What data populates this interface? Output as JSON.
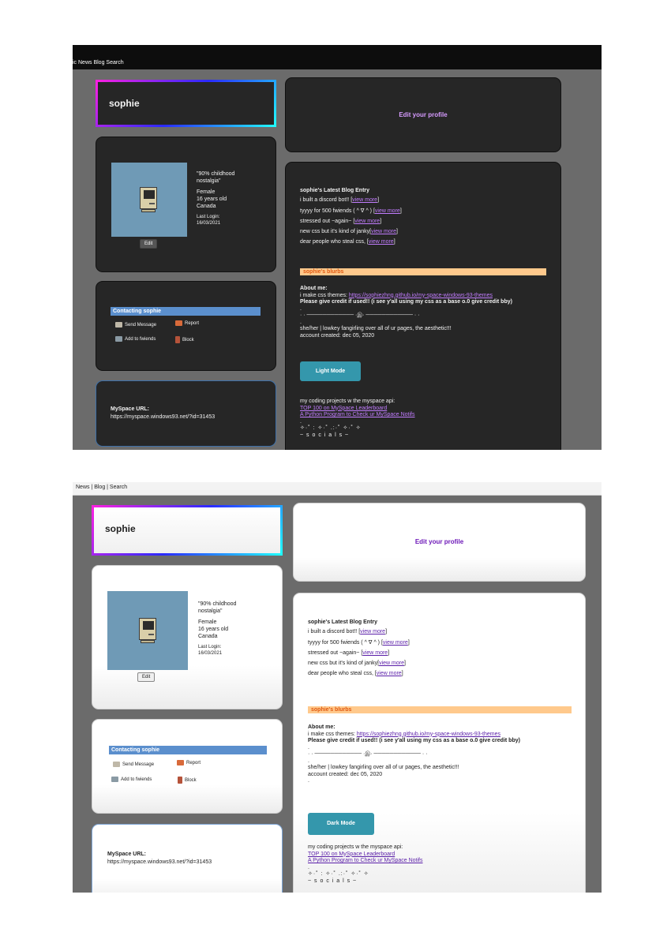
{
  "nav": {
    "dark": "ic News Blog Search",
    "light": "News | Blog | Search"
  },
  "profile": {
    "name": "sophie",
    "headline": "\"90% childhood nostalgia\"",
    "gender": "Female",
    "age": "16 years old",
    "country": "Canada",
    "last_login_label": "Last Login:",
    "last_login": "16/03/2021",
    "edit_button": "Edit"
  },
  "edit_profile_link": "Edit your profile",
  "contact": {
    "title": "Contacting sophie",
    "send_message": "Send Message",
    "report": "Report",
    "add_friends": "Add to fwiends",
    "block": "Block"
  },
  "myspace_url": {
    "label": "MySpace URL:",
    "value": "https://myspace.windows93.net/?id=31453"
  },
  "blog": {
    "title": "sophie's Latest Blog Entry",
    "view_more": "view more",
    "entries": [
      "i built a discord bot!!",
      "tyyyy for 500 fwiends ( ^ ∇ ^ )",
      "stressed out ~again~",
      "new css but it's kind of janky",
      "dear people who steal css,"
    ]
  },
  "blurbs": {
    "title": "sophie's blurbs",
    "about_label": "About me:",
    "themes_prefix": "i make css themes:",
    "themes_link": "https://sophiezhng.github.io/my-space-windows-93-themes",
    "credit_note": "Please give credit if used!! (i see y'all using my css as a base o.0 give credit bby)",
    "dot": ".",
    "divider": "· · ──────────── ·இ· ──────────── · ·",
    "pronouns": "she/her | lowkey fangirling over all of ur pages, the aesthetic!!!",
    "account_created": "account created: dec 05, 2020",
    "light_mode_button": "Light Mode",
    "dark_mode_button": "Dark Mode",
    "coding_intro": "my coding projects w the myspace api:",
    "project_1": "TOP 100 on MySpace Leaderboard",
    "project_2": "A Python Program to Check ur MySpace Notifs",
    "sparkles": "✧·˚ : ✧·˚  .:·˚ ✧·˚ ✧",
    "socials": "~ s o c i a l s ~"
  },
  "colors": {
    "dark_card": "#262626",
    "light_card": "#ffffff",
    "contact_bar": "#5b8fcd",
    "blurbs_bar": "#ffc98c",
    "mode_button": "#3497ac",
    "link_dark": "#c27dff",
    "link_light": "#5a1ea8"
  }
}
